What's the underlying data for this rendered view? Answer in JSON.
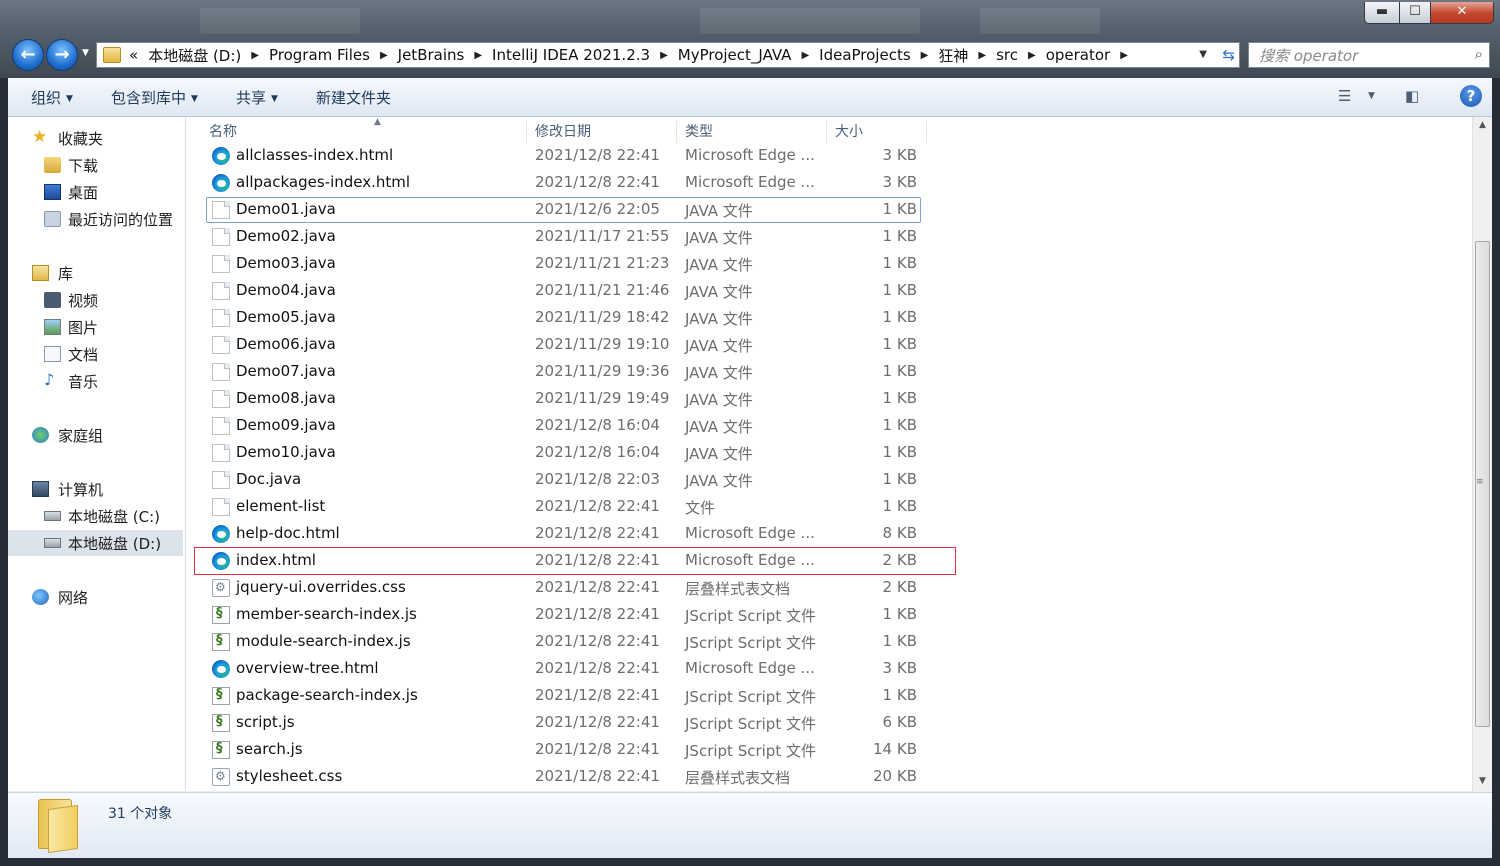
{
  "address": {
    "overflow": "«",
    "crumbs": [
      "本地磁盘 (D:)",
      "Program Files",
      "JetBrains",
      "IntelliJ IDEA 2021.2.3",
      "MyProject_JAVA",
      "IdeaProjects",
      "狂神",
      "src",
      "operator"
    ]
  },
  "search": {
    "placeholder": "搜索 operator"
  },
  "toolbar": {
    "organize": "组织",
    "include_library": "包含到库中",
    "share": "共享",
    "new_folder": "新建文件夹"
  },
  "nav": {
    "favorites": "收藏夹",
    "downloads": "下载",
    "desktop": "桌面",
    "recent": "最近访问的位置",
    "libraries": "库",
    "videos": "视频",
    "pictures": "图片",
    "documents": "文档",
    "music": "音乐",
    "homegroup": "家庭组",
    "computer": "计算机",
    "drive_c": "本地磁盘 (C:)",
    "drive_d": "本地磁盘 (D:)",
    "network": "网络"
  },
  "columns": {
    "name": "名称",
    "date": "修改日期",
    "type": "类型",
    "size": "大小"
  },
  "files": [
    {
      "name": "allclasses-index.html",
      "date": "2021/12/8 22:41",
      "type": "Microsoft Edge ...",
      "size": "3 KB",
      "icon": "edge"
    },
    {
      "name": "allpackages-index.html",
      "date": "2021/12/8 22:41",
      "type": "Microsoft Edge ...",
      "size": "3 KB",
      "icon": "edge"
    },
    {
      "name": "Demo01.java",
      "date": "2021/12/6 22:05",
      "type": "JAVA 文件",
      "size": "1 KB",
      "icon": "doc"
    },
    {
      "name": "Demo02.java",
      "date": "2021/11/17 21:55",
      "type": "JAVA 文件",
      "size": "1 KB",
      "icon": "doc"
    },
    {
      "name": "Demo03.java",
      "date": "2021/11/21 21:23",
      "type": "JAVA 文件",
      "size": "1 KB",
      "icon": "doc"
    },
    {
      "name": "Demo04.java",
      "date": "2021/11/21 21:46",
      "type": "JAVA 文件",
      "size": "1 KB",
      "icon": "doc"
    },
    {
      "name": "Demo05.java",
      "date": "2021/11/29 18:42",
      "type": "JAVA 文件",
      "size": "1 KB",
      "icon": "doc"
    },
    {
      "name": "Demo06.java",
      "date": "2021/11/29 19:10",
      "type": "JAVA 文件",
      "size": "1 KB",
      "icon": "doc"
    },
    {
      "name": "Demo07.java",
      "date": "2021/11/29 19:36",
      "type": "JAVA 文件",
      "size": "1 KB",
      "icon": "doc"
    },
    {
      "name": "Demo08.java",
      "date": "2021/11/29 19:49",
      "type": "JAVA 文件",
      "size": "1 KB",
      "icon": "doc"
    },
    {
      "name": "Demo09.java",
      "date": "2021/12/8 16:04",
      "type": "JAVA 文件",
      "size": "1 KB",
      "icon": "doc"
    },
    {
      "name": "Demo10.java",
      "date": "2021/12/8 16:04",
      "type": "JAVA 文件",
      "size": "1 KB",
      "icon": "doc"
    },
    {
      "name": "Doc.java",
      "date": "2021/12/8 22:03",
      "type": "JAVA 文件",
      "size": "1 KB",
      "icon": "doc"
    },
    {
      "name": "element-list",
      "date": "2021/12/8 22:41",
      "type": "文件",
      "size": "1 KB",
      "icon": "doc"
    },
    {
      "name": "help-doc.html",
      "date": "2021/12/8 22:41",
      "type": "Microsoft Edge ...",
      "size": "8 KB",
      "icon": "edge"
    },
    {
      "name": "index.html",
      "date": "2021/12/8 22:41",
      "type": "Microsoft Edge ...",
      "size": "2 KB",
      "icon": "edge"
    },
    {
      "name": "jquery-ui.overrides.css",
      "date": "2021/12/8 22:41",
      "type": "层叠样式表文档",
      "size": "2 KB",
      "icon": "css"
    },
    {
      "name": "member-search-index.js",
      "date": "2021/12/8 22:41",
      "type": "JScript Script 文件",
      "size": "1 KB",
      "icon": "js"
    },
    {
      "name": "module-search-index.js",
      "date": "2021/12/8 22:41",
      "type": "JScript Script 文件",
      "size": "1 KB",
      "icon": "js"
    },
    {
      "name": "overview-tree.html",
      "date": "2021/12/8 22:41",
      "type": "Microsoft Edge ...",
      "size": "3 KB",
      "icon": "edge"
    },
    {
      "name": "package-search-index.js",
      "date": "2021/12/8 22:41",
      "type": "JScript Script 文件",
      "size": "1 KB",
      "icon": "js"
    },
    {
      "name": "script.js",
      "date": "2021/12/8 22:41",
      "type": "JScript Script 文件",
      "size": "6 KB",
      "icon": "js"
    },
    {
      "name": "search.js",
      "date": "2021/12/8 22:41",
      "type": "JScript Script 文件",
      "size": "14 KB",
      "icon": "js"
    },
    {
      "name": "stylesheet.css",
      "date": "2021/12/8 22:41",
      "type": "层叠样式表文档",
      "size": "20 KB",
      "icon": "css"
    }
  ],
  "status": {
    "count": "31 个对象"
  },
  "colors": {
    "highlight": "#e0303a",
    "accent": "#1e395b"
  }
}
